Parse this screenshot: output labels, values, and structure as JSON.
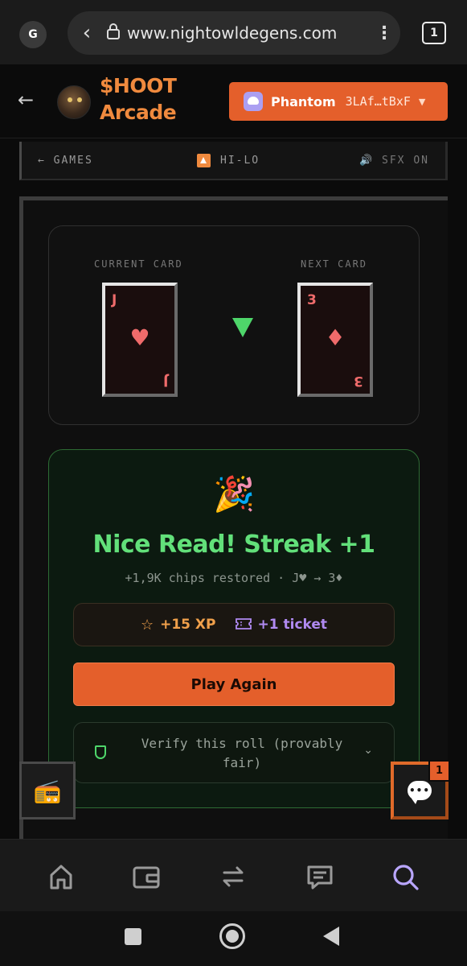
{
  "browser": {
    "profile_initial": "G",
    "url": "www.nightowldegens.com",
    "tab_count": "1"
  },
  "header": {
    "brand_line1": "$HOOT",
    "brand_line2": "Arcade",
    "wallet_name": "Phantom",
    "wallet_address": "3LAf…tBxF"
  },
  "subnav": {
    "games_label": "← GAMES",
    "game_label": "HI-LO",
    "sfx_label": "SFX ON"
  },
  "cards": {
    "current_label": "CURRENT CARD",
    "next_label": "NEXT CARD",
    "current": {
      "rank": "J",
      "suit": "♥"
    },
    "next": {
      "rank": "3",
      "suit": "♦"
    },
    "direction": "down"
  },
  "result": {
    "emoji": "🎉",
    "title": "Nice Read! Streak +1",
    "subtitle": "+1,9K chips restored · J♥ → 3♦",
    "xp": "+15 XP",
    "ticket": "+1 ticket",
    "play_again": "Play Again",
    "verify": "Verify this roll (provably fair)"
  },
  "floating": {
    "chat_badge": "1"
  },
  "colors": {
    "accent": "#e45f2b",
    "success": "#62e07a",
    "xp": "#f0a04b",
    "ticket": "#b08af2",
    "nav_active": "#b9a6ff"
  },
  "bottom_nav": {
    "items": [
      "home-icon",
      "wallet-icon",
      "swap-icon",
      "messages-icon",
      "search-icon"
    ],
    "active": "search-icon"
  }
}
